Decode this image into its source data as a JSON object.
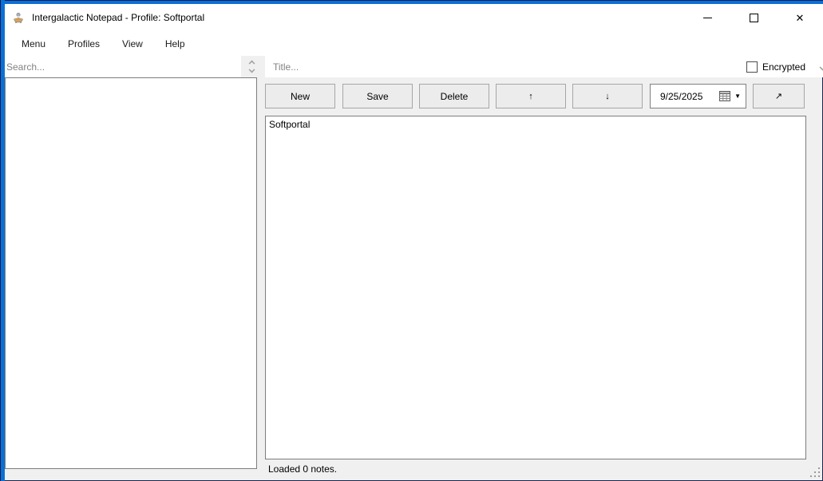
{
  "window": {
    "title": "Intergalactic Notepad - Profile: Softportal"
  },
  "menu": {
    "items": [
      "Menu",
      "Profiles",
      "View",
      "Help"
    ]
  },
  "left_panel": {
    "search_placeholder": "Search...",
    "notes_list_items": []
  },
  "note_editor": {
    "title_placeholder": "Title...",
    "encrypted_label": "Encrypted",
    "encrypted_checked": false,
    "content": "Softportal",
    "date_value": "9/25/2025"
  },
  "toolbar": {
    "new_label": "New",
    "save_label": "Save",
    "delete_label": "Delete",
    "move_up_glyph": "↑",
    "move_down_glyph": "↓",
    "open_glyph": "↗"
  },
  "status_bar": {
    "text": "Loaded 0 notes."
  },
  "icons": {
    "app_icon": "lamp",
    "minimize": "line",
    "maximize": "square-outline",
    "close": "✕",
    "search_spinner_up": "chevron-up",
    "search_spinner_down": "chevron-down",
    "title_spinner_down": "chevron-down",
    "calendar": "calendar-grid",
    "date_dropdown": "▼",
    "resize_grip": "dot-triangle"
  },
  "colors": {
    "accent_border": "#0a70d6",
    "accent_border_dark": "#101b50",
    "form_background": "#f0f0f0",
    "titlebar_background": "#ffffff",
    "button_background": "#ececec",
    "button_border": "#a6a6a6",
    "box_border": "#7d7d7d",
    "placeholder_text": "#838383"
  }
}
